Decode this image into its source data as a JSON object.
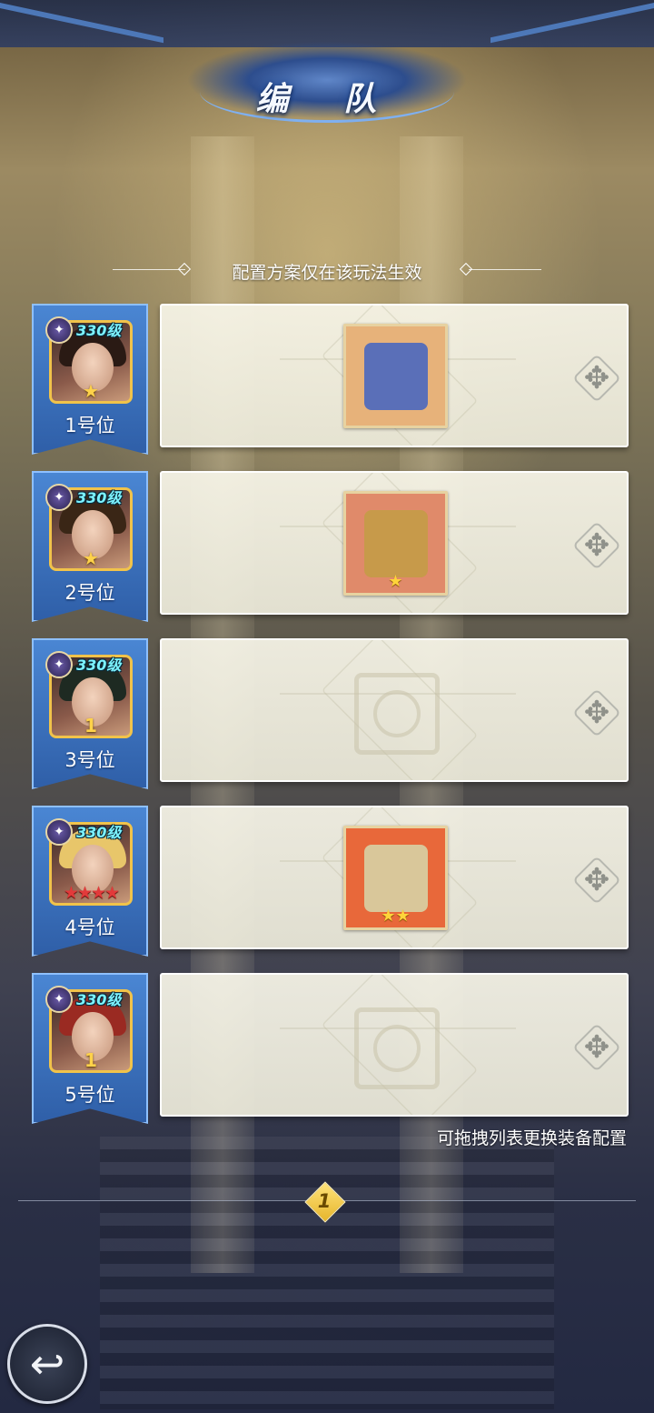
{
  "header": {
    "title": "编 队"
  },
  "subtitle": "配置方案仅在该玩法生效",
  "slots": [
    {
      "label": "1号位",
      "level": "330级",
      "faction_icon": "void-faction-icon",
      "rank": "★",
      "rank_style": "gold",
      "portrait_hair": "#2a1a14",
      "item": {
        "type": "equipped",
        "icon": "winged-tome-icon",
        "stars": "",
        "bg": "#e7b27a",
        "glyph": "#5a6fb8"
      }
    },
    {
      "label": "2号位",
      "level": "330级",
      "faction_icon": "light-faction-icon",
      "rank": "★",
      "rank_style": "gold",
      "portrait_hair": "#3a2616",
      "item": {
        "type": "equipped",
        "icon": "lion-crest-icon",
        "stars": "★",
        "bg": "#e08a6a",
        "glyph": "#c79a4a"
      }
    },
    {
      "label": "3号位",
      "level": "330级",
      "faction_icon": "void-faction-icon",
      "rank": "1",
      "rank_style": "num",
      "portrait_hair": "#1e2a22",
      "item": {
        "type": "empty",
        "icon": "empty-equipment-slot-icon",
        "stars": "",
        "bg": "",
        "glyph": ""
      }
    },
    {
      "label": "4号位",
      "level": "330级",
      "faction_icon": "light-faction-icon",
      "rank": "★★★★",
      "rank_style": "red",
      "portrait_hair": "#e8c66a",
      "item": {
        "type": "equipped",
        "icon": "golden-book-icon",
        "stars": "★★",
        "bg": "#e8683a",
        "glyph": "#d9c79a"
      }
    },
    {
      "label": "5号位",
      "level": "330级",
      "faction_icon": "void-faction-icon",
      "rank": "1",
      "rank_style": "num",
      "portrait_hair": "#9a2a22",
      "item": {
        "type": "empty",
        "icon": "empty-equipment-slot-icon",
        "stars": "",
        "bg": "",
        "glyph": ""
      }
    }
  ],
  "hint": "可拖拽列表更换装备配置",
  "pager": {
    "current_page": "1"
  },
  "controls": {
    "back_icon": "back-arrow-icon",
    "drag_icon": "move-drag-icon"
  }
}
